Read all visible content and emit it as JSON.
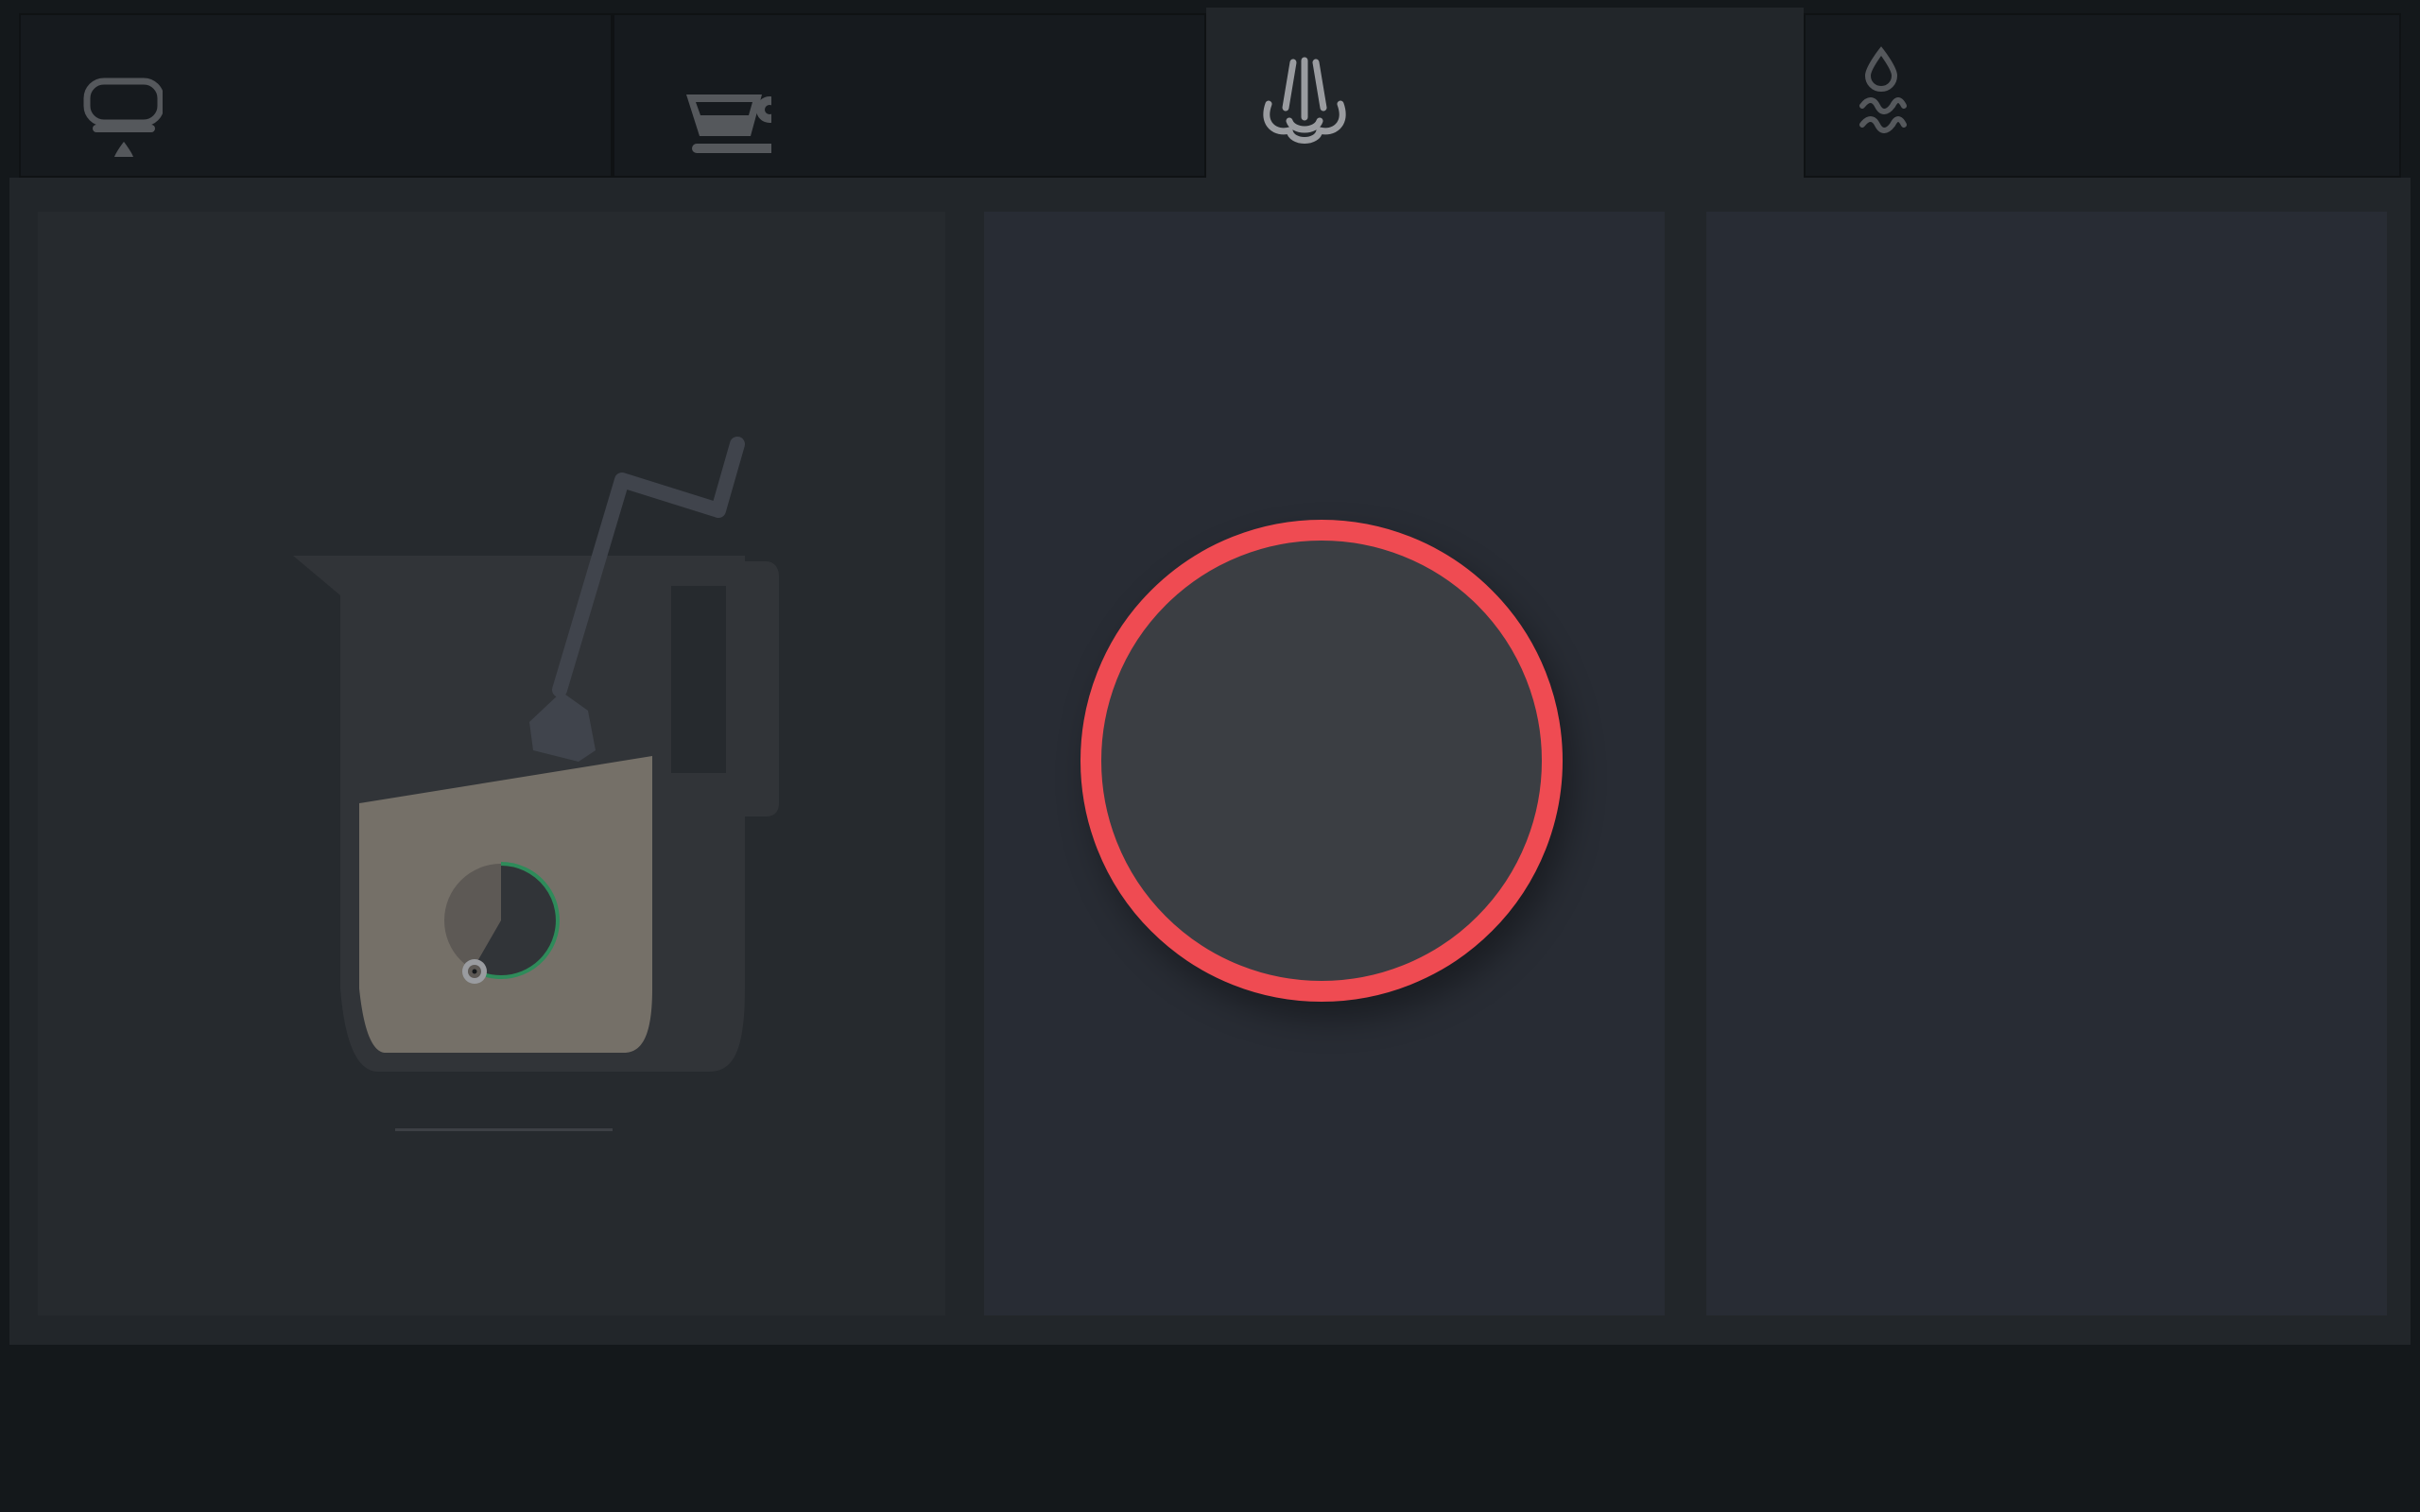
{
  "tabs": [
    {
      "id": "espresso",
      "icon": "espresso-drip-icon",
      "label": "",
      "active": false
    },
    {
      "id": "coffee",
      "icon": "coffee-cup-icon",
      "label": "",
      "active": false
    },
    {
      "id": "steam",
      "icon": "steam-wand-icon",
      "label": "",
      "active": true
    },
    {
      "id": "hot-water",
      "icon": "hot-water-icon",
      "label": "",
      "active": false
    }
  ],
  "steam": {
    "pitcher_icon": "milk-pitcher-steam-icon",
    "progress_icon": "timer-progress-icon",
    "start_button_icon": "start-button",
    "start_button_label": ""
  },
  "colors": {
    "background": "#14181b",
    "panel": "#282c34",
    "accent_red": "#ef4b52",
    "milk": "#757068",
    "progress_green": "#2e8b5a"
  }
}
